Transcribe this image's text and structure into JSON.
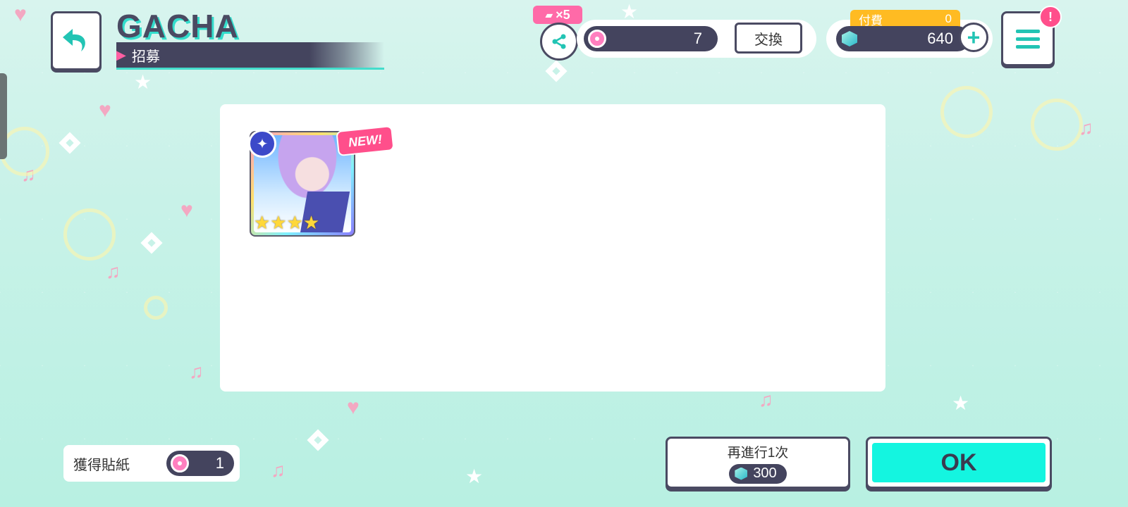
{
  "header": {
    "title": "GACHA",
    "subtitle": "招募"
  },
  "share": {
    "badge": "×5"
  },
  "stickers": {
    "count": "7",
    "exchange_label": "交換"
  },
  "crystals": {
    "paid_label": "付費",
    "paid_count": "0",
    "count": "640",
    "plus": "+"
  },
  "menu": {
    "notification": "!"
  },
  "result": {
    "cards": [
      {
        "tag": "NEW!",
        "rarity_stars": 4,
        "stars_text": "★★★★",
        "attribute_icon": "star-attribute-icon"
      }
    ]
  },
  "obtained": {
    "label": "獲得貼紙",
    "count": "1"
  },
  "buttons": {
    "again_label": "再進行1次",
    "again_cost": "300",
    "ok_label": "OK"
  },
  "colors": {
    "accent_teal": "#14f5e0",
    "dark": "#44445e",
    "pink": "#ff4f8b",
    "gold": "#ffbb22"
  }
}
